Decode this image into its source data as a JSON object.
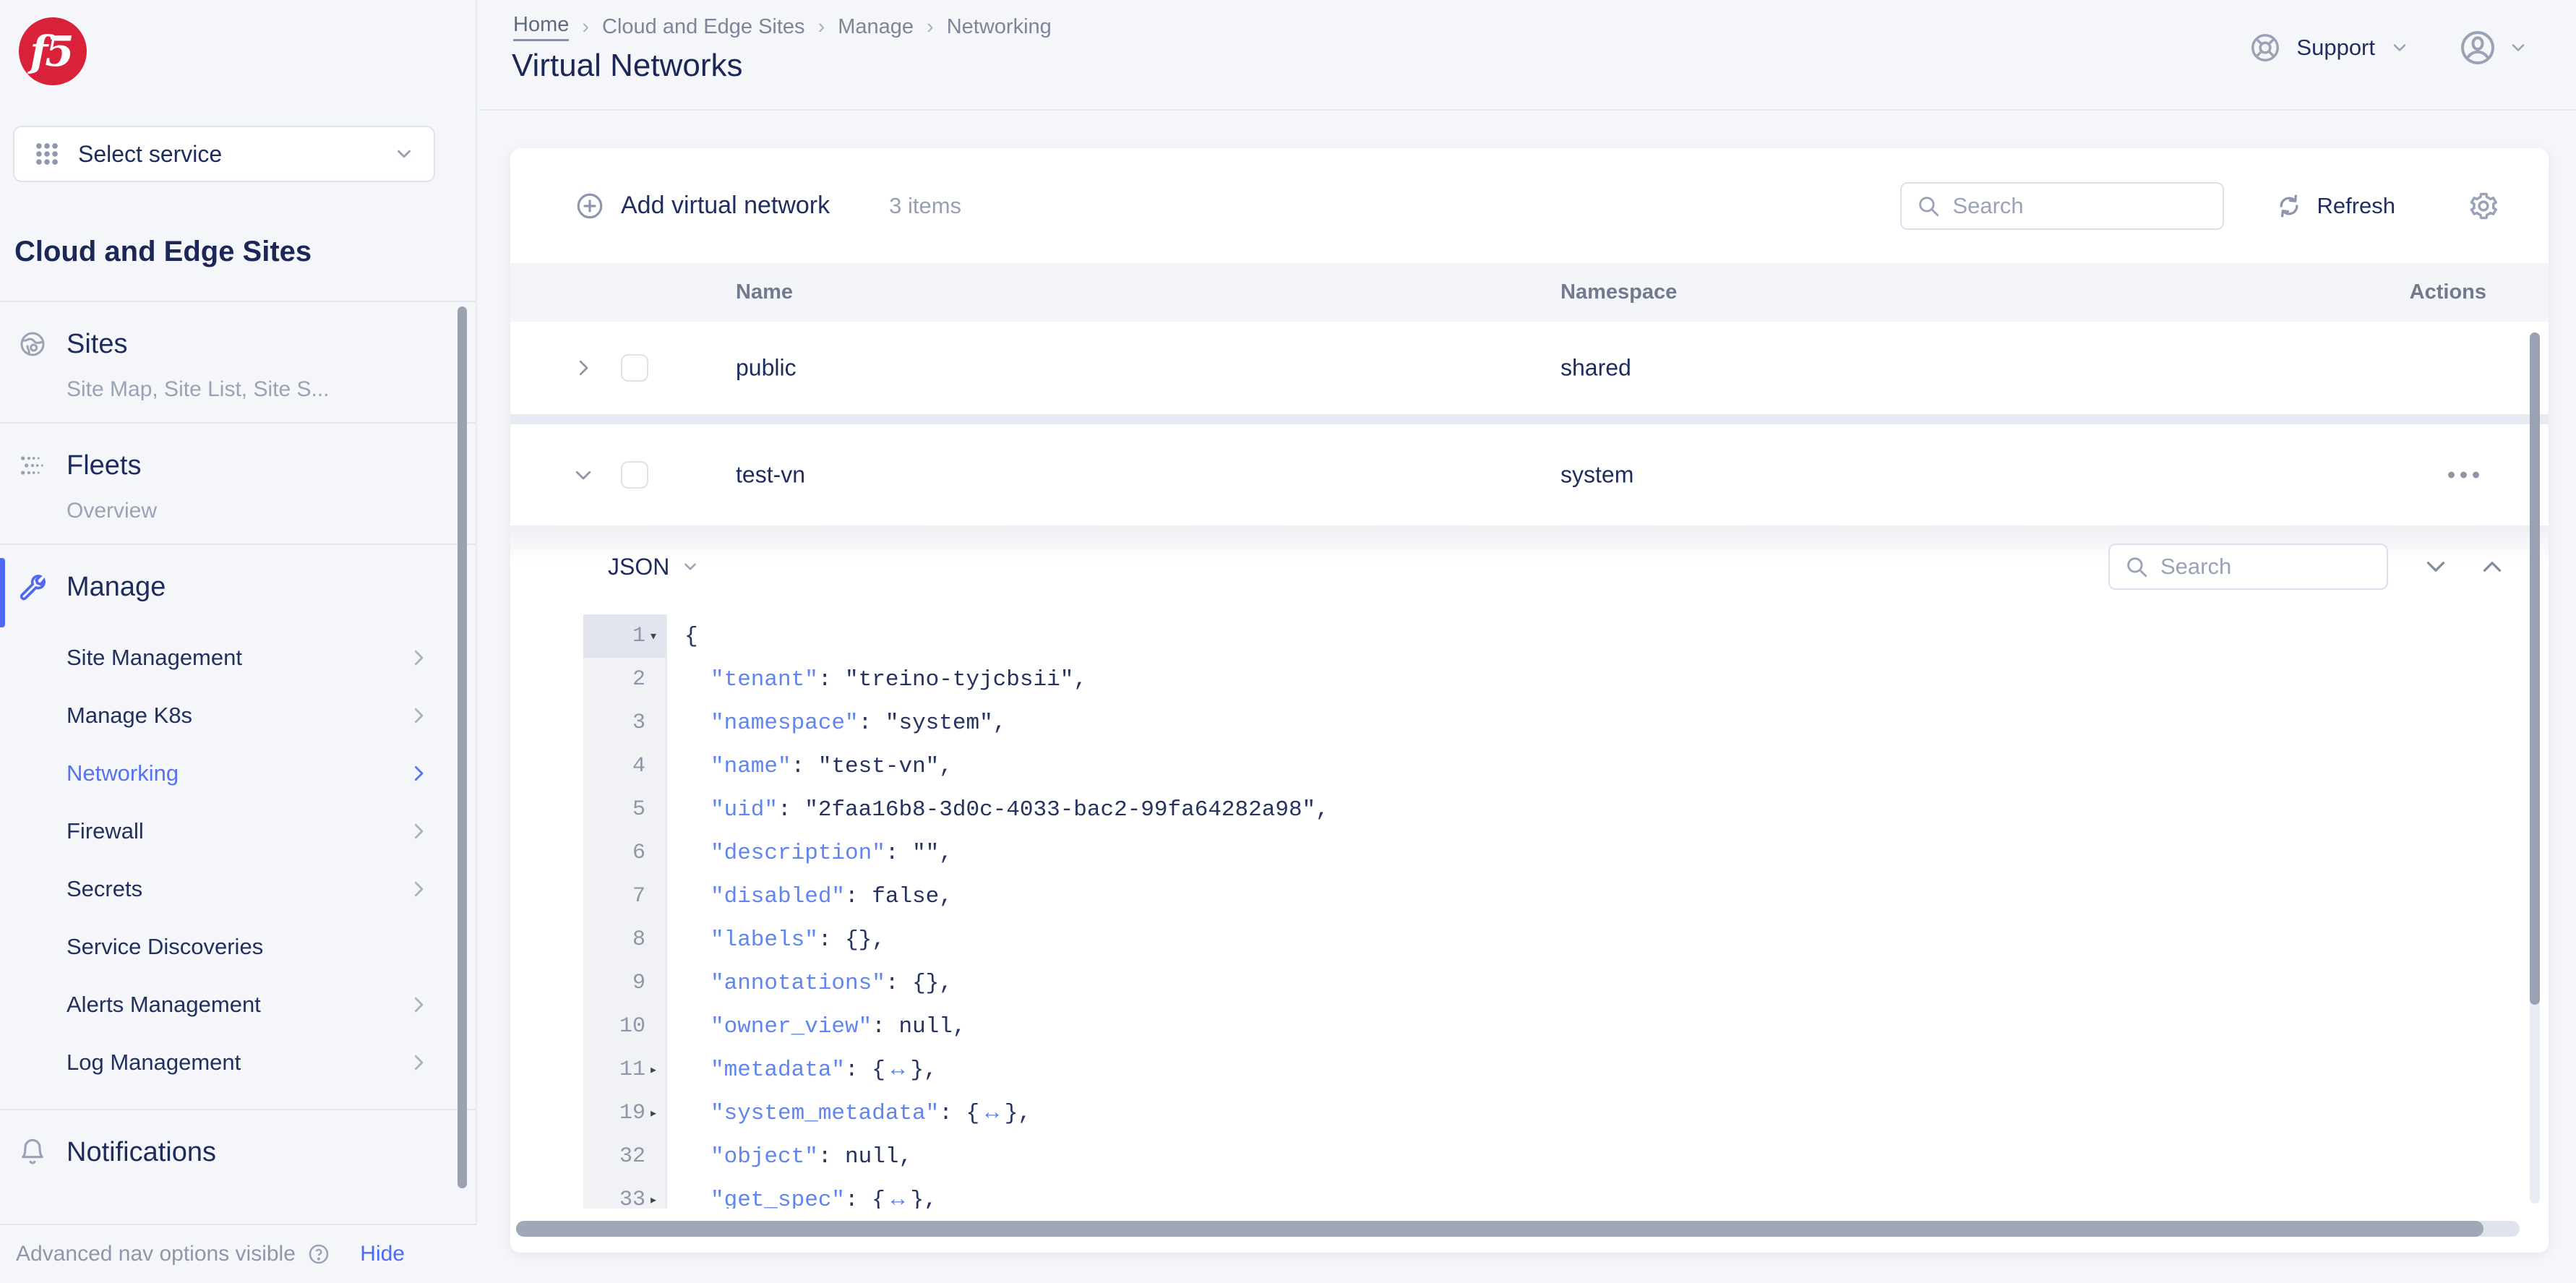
{
  "sidebar": {
    "logo_text": "f5",
    "select_service": "Select service",
    "heading": "Cloud and Edge Sites",
    "sections": [
      {
        "title": "Sites",
        "subtitle": "Site Map, Site List, Site S...",
        "icon": "globe-icon"
      },
      {
        "title": "Fleets",
        "subtitle": "Overview",
        "icon": "fleet-dots-icon"
      },
      {
        "title": "Manage",
        "icon": "wrench-icon",
        "active": true,
        "children": [
          {
            "label": "Site Management",
            "chevron": true
          },
          {
            "label": "Manage K8s",
            "chevron": true
          },
          {
            "label": "Networking",
            "chevron": true,
            "active": true
          },
          {
            "label": "Firewall",
            "chevron": true
          },
          {
            "label": "Secrets",
            "chevron": true
          },
          {
            "label": "Service Discoveries",
            "chevron": false
          },
          {
            "label": "Alerts Management",
            "chevron": true
          },
          {
            "label": "Log Management",
            "chevron": true
          }
        ]
      },
      {
        "title": "Notifications",
        "icon": "bell-icon"
      }
    ],
    "footer": {
      "text": "Advanced nav options visible",
      "action": "Hide"
    }
  },
  "header": {
    "breadcrumb": [
      "Home",
      "Cloud and Edge Sites",
      "Manage",
      "Networking"
    ],
    "title": "Virtual Networks",
    "support_label": "Support"
  },
  "toolbar": {
    "add_label": "Add virtual network",
    "items_count": "3 items",
    "search_placeholder": "Search",
    "refresh_label": "Refresh"
  },
  "table": {
    "columns": [
      "Name",
      "Namespace",
      "Actions"
    ],
    "rows": [
      {
        "name": "public",
        "namespace": "shared",
        "expanded": false,
        "has_actions": false
      },
      {
        "name": "test-vn",
        "namespace": "system",
        "expanded": true,
        "has_actions": true
      }
    ]
  },
  "json_viewer": {
    "format_label": "JSON",
    "search_placeholder": "Search",
    "accent_key_color": "#6185f0",
    "lines": [
      {
        "num": "1",
        "fold": "open",
        "indent": 0,
        "tokens": [
          [
            "p",
            "{"
          ]
        ]
      },
      {
        "num": "2",
        "fold": null,
        "indent": 1,
        "tokens": [
          [
            "k",
            "\"tenant\""
          ],
          [
            "p",
            ": "
          ],
          [
            "v",
            "\"treino-tyjcbsii\""
          ],
          [
            "p",
            ","
          ]
        ]
      },
      {
        "num": "3",
        "fold": null,
        "indent": 1,
        "tokens": [
          [
            "k",
            "\"namespace\""
          ],
          [
            "p",
            ": "
          ],
          [
            "v",
            "\"system\""
          ],
          [
            "p",
            ","
          ]
        ]
      },
      {
        "num": "4",
        "fold": null,
        "indent": 1,
        "tokens": [
          [
            "k",
            "\"name\""
          ],
          [
            "p",
            ": "
          ],
          [
            "v",
            "\"test-vn\""
          ],
          [
            "p",
            ","
          ]
        ]
      },
      {
        "num": "5",
        "fold": null,
        "indent": 1,
        "tokens": [
          [
            "k",
            "\"uid\""
          ],
          [
            "p",
            ": "
          ],
          [
            "v",
            "\"2faa16b8-3d0c-4033-bac2-99fa64282a98\""
          ],
          [
            "p",
            ","
          ]
        ]
      },
      {
        "num": "6",
        "fold": null,
        "indent": 1,
        "tokens": [
          [
            "k",
            "\"description\""
          ],
          [
            "p",
            ": "
          ],
          [
            "v",
            "\"\""
          ],
          [
            "p",
            ","
          ]
        ]
      },
      {
        "num": "7",
        "fold": null,
        "indent": 1,
        "tokens": [
          [
            "k",
            "\"disabled\""
          ],
          [
            "p",
            ": "
          ],
          [
            "v",
            "false"
          ],
          [
            "p",
            ","
          ]
        ]
      },
      {
        "num": "8",
        "fold": null,
        "indent": 1,
        "tokens": [
          [
            "k",
            "\"labels\""
          ],
          [
            "p",
            ": "
          ],
          [
            "v",
            "{}"
          ],
          [
            "p",
            ","
          ]
        ]
      },
      {
        "num": "9",
        "fold": null,
        "indent": 1,
        "tokens": [
          [
            "k",
            "\"annotations\""
          ],
          [
            "p",
            ": "
          ],
          [
            "v",
            "{}"
          ],
          [
            "p",
            ","
          ]
        ]
      },
      {
        "num": "10",
        "fold": null,
        "indent": 1,
        "tokens": [
          [
            "k",
            "\"owner_view\""
          ],
          [
            "p",
            ": "
          ],
          [
            "v",
            "null"
          ],
          [
            "p",
            ","
          ]
        ]
      },
      {
        "num": "11",
        "fold": "closed",
        "indent": 1,
        "tokens": [
          [
            "k",
            "\"metadata\""
          ],
          [
            "p",
            ": {"
          ],
          [
            "a",
            "↔"
          ],
          [
            "p",
            "},"
          ]
        ]
      },
      {
        "num": "19",
        "fold": "closed",
        "indent": 1,
        "tokens": [
          [
            "k",
            "\"system_metadata\""
          ],
          [
            "p",
            ": {"
          ],
          [
            "a",
            "↔"
          ],
          [
            "p",
            "},"
          ]
        ]
      },
      {
        "num": "32",
        "fold": null,
        "indent": 1,
        "tokens": [
          [
            "k",
            "\"object\""
          ],
          [
            "p",
            ": "
          ],
          [
            "v",
            "null"
          ],
          [
            "p",
            ","
          ]
        ]
      },
      {
        "num": "33",
        "fold": "closed",
        "indent": 1,
        "tokens": [
          [
            "k",
            "\"get_spec\""
          ],
          [
            "p",
            ": {"
          ],
          [
            "a",
            "↔"
          ],
          [
            "p",
            "},"
          ]
        ]
      }
    ]
  }
}
